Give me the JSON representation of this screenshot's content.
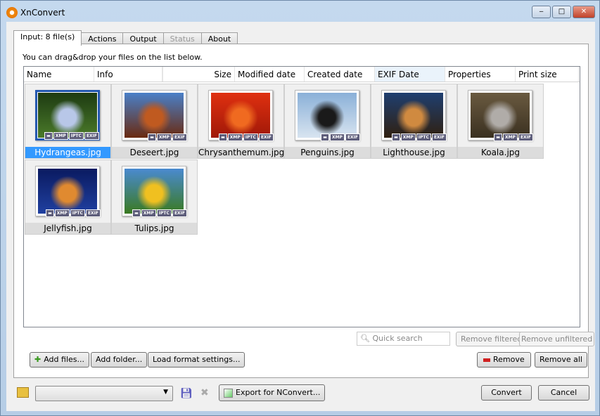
{
  "window": {
    "title": "XnConvert",
    "minimize": "‒",
    "maximize": "□",
    "close": "✕"
  },
  "tabs": [
    {
      "label": "Input: 8 file(s)",
      "state": "active"
    },
    {
      "label": "Actions",
      "state": "normal"
    },
    {
      "label": "Output",
      "state": "normal"
    },
    {
      "label": "Status",
      "state": "disabled"
    },
    {
      "label": "About",
      "state": "normal"
    }
  ],
  "hint": "You can drag&drop your files on the list below.",
  "columns": [
    "Name",
    "Info",
    "",
    "Size",
    "Modified date",
    "Created date",
    "EXIF Date",
    "Properties",
    "Print size"
  ],
  "files": [
    {
      "name": "Hydrangeas.jpg",
      "badges": [
        "▬",
        "XMP",
        "IPTC",
        "EXIF"
      ],
      "colors": [
        "#1d3a12",
        "#b8c7e8",
        "#4b7a2a"
      ],
      "selected": true
    },
    {
      "name": "Deseert.jpg",
      "badges": [
        "▬",
        "XMP",
        "EXIF"
      ],
      "colors": [
        "#4a80c8",
        "#c05a20",
        "#6a2a10"
      ]
    },
    {
      "name": "Chrysanthemum.jpg",
      "badges": [
        "▬",
        "XMP",
        "IPTC",
        "EXIF"
      ],
      "colors": [
        "#e03010",
        "#f06a20",
        "#a01808"
      ]
    },
    {
      "name": "Penguins.jpg",
      "badges": [
        "▬",
        "XMP",
        "EXIF"
      ],
      "colors": [
        "#8ab0d8",
        "#1a1a1a",
        "#d8e4f0"
      ]
    },
    {
      "name": "Lighthouse.jpg",
      "badges": [
        "▬",
        "XMP",
        "IPTC",
        "EXIF"
      ],
      "colors": [
        "#1f3f70",
        "#d08a40",
        "#302010"
      ]
    },
    {
      "name": "Koala.jpg",
      "badges": [
        "▬",
        "XMP",
        "EXIF"
      ],
      "colors": [
        "#6a5a40",
        "#b0aca8",
        "#3a3020"
      ]
    },
    {
      "name": "Jellyfish.jpg",
      "badges": [
        "▬",
        "XMP",
        "IPTC",
        "EXIF"
      ],
      "colors": [
        "#0a1a60",
        "#e08a30",
        "#2040a0"
      ]
    },
    {
      "name": "Tulips.jpg",
      "badges": [
        "▬",
        "XMP",
        "IPTC",
        "EXIF"
      ],
      "colors": [
        "#4a8ad0",
        "#f0c020",
        "#3a7a20"
      ]
    }
  ],
  "search": {
    "placeholder": "Quick search"
  },
  "buttons": {
    "remove_filtered": "Remove filtered",
    "remove_unfiltered": "Remove unfiltered",
    "add_files": "Add files...",
    "add_folder": "Add folder...",
    "load_format": "Load format settings...",
    "remove": "Remove",
    "remove_all": "Remove all",
    "export": "Export for NConvert...",
    "convert": "Convert",
    "cancel": "Cancel"
  }
}
